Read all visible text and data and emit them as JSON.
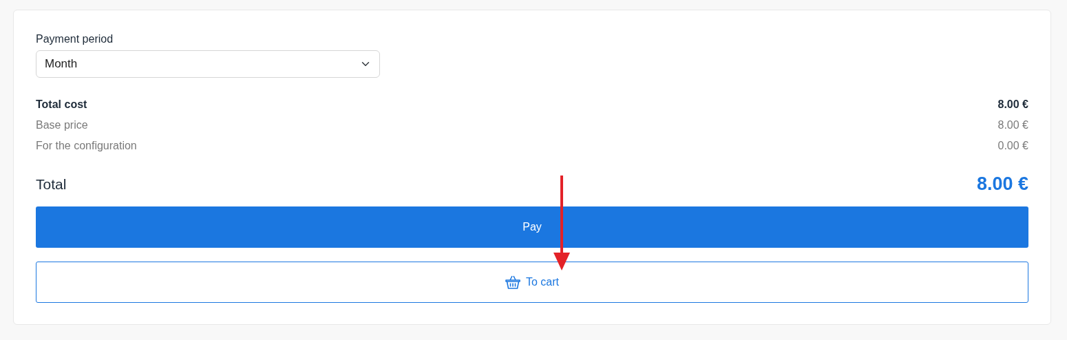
{
  "payment_period": {
    "label": "Payment period",
    "value": "Month"
  },
  "cost_rows": [
    {
      "label": "Total cost",
      "value": "8.00 €",
      "kind": "heading"
    },
    {
      "label": "Base price",
      "value": "8.00 €",
      "kind": "detail"
    },
    {
      "label": "For the configuration",
      "value": "0.00 €",
      "kind": "detail"
    }
  ],
  "total": {
    "label": "Total",
    "value": "8.00 €"
  },
  "buttons": [
    {
      "label": "Pay",
      "kind": "primary"
    },
    {
      "label": "To cart",
      "kind": "cart"
    }
  ]
}
